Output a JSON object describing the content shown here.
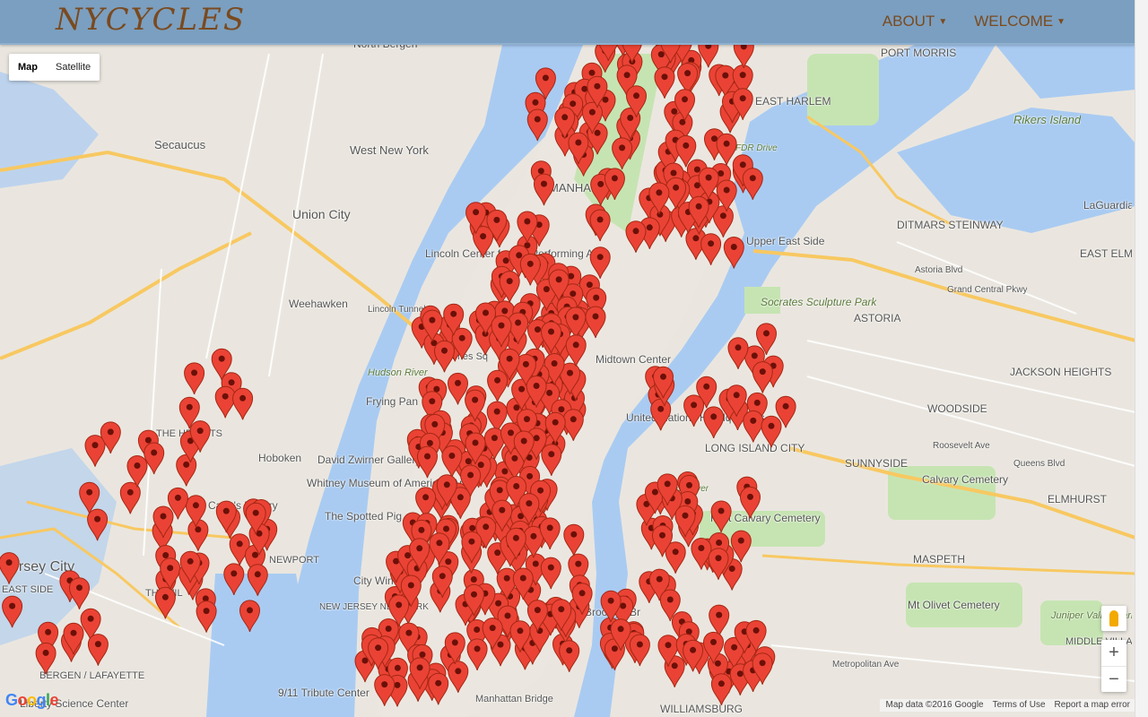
{
  "app": {
    "brand": "NYCYCLES",
    "nav": [
      {
        "label": "ABOUT"
      },
      {
        "label": "WELCOME"
      }
    ]
  },
  "map": {
    "type_controls": {
      "map": "Map",
      "satellite": "Satellite"
    },
    "zoom": {
      "in": "+",
      "out": "−"
    },
    "attribution": {
      "data": "Map data ©2016 Google",
      "terms": "Terms of Use",
      "report": "Report a map error"
    },
    "google_logo": "Google",
    "colors": {
      "water": "#a9cbf2",
      "land": "#eae6df",
      "park": "#c6e4b2",
      "highway": "#f8c861",
      "marker": "#ea4335"
    },
    "labels": [
      {
        "text": "North Bergen"
      },
      {
        "text": "PORT MORRIS"
      },
      {
        "text": "EAST HARLEM"
      },
      {
        "text": "Rikers Island"
      },
      {
        "text": "Secaucus"
      },
      {
        "text": "West New York"
      },
      {
        "text": "Union City"
      },
      {
        "text": "LaGuardia Airport"
      },
      {
        "text": "DITMARS STEINWAY"
      },
      {
        "text": "EAST ELMH"
      },
      {
        "text": "Lincoln Center for the Performing Arts"
      },
      {
        "text": "Weehawken"
      },
      {
        "text": "Socrates Sculpture Park"
      },
      {
        "text": "ASTORIA"
      },
      {
        "text": "JACKSON HEIGHTS"
      },
      {
        "text": "Frying Pan"
      },
      {
        "text": "United Nations Headquarters"
      },
      {
        "text": "WOODSIDE"
      },
      {
        "text": "LONG ISLAND CITY"
      },
      {
        "text": "Hoboken"
      },
      {
        "text": "David Zwirner Gallery"
      },
      {
        "text": "SUNNYSIDE"
      },
      {
        "text": "Calvary Cemetery"
      },
      {
        "text": "ELMHURST"
      },
      {
        "text": "Whitney Museum of American Art"
      },
      {
        "text": "Carlo's Bakery"
      },
      {
        "text": "The Spotted Pig"
      },
      {
        "text": "First Calvary Cemetery"
      },
      {
        "text": "Jersey City"
      },
      {
        "text": "NEWPORT"
      },
      {
        "text": "MASPETH"
      },
      {
        "text": "City Wine"
      },
      {
        "text": "EAST SIDE"
      },
      {
        "text": "THE HEIGHTS"
      },
      {
        "text": "THE VIL"
      },
      {
        "text": "Mt Olivet Cemetery"
      },
      {
        "text": "Juniper Valley Park"
      },
      {
        "text": "Brooklyn Br"
      },
      {
        "text": "MIDDLE VILLA"
      },
      {
        "text": "BERGEN / LAFAYETTE"
      },
      {
        "text": "9/11 Tribute Center"
      },
      {
        "text": "Liberty Science Center"
      },
      {
        "text": "WILLIAMSBURG"
      },
      {
        "text": "Manhattan Bridge"
      },
      {
        "text": "Hudson River"
      },
      {
        "text": "East River"
      },
      {
        "text": "Lincoln Tunnel"
      },
      {
        "text": "FDR Drive"
      },
      {
        "text": "Grand Central Pkwy"
      },
      {
        "text": "MANHATTAN"
      },
      {
        "text": "Upper East Side"
      },
      {
        "text": "Astoria Blvd"
      },
      {
        "text": "Roosevelt Ave"
      },
      {
        "text": "Queens Blvd"
      },
      {
        "text": "NEW JERSEY NEW YORK"
      },
      {
        "text": "Midtown Center"
      },
      {
        "text": "Times Sq"
      },
      {
        "text": "Metropolitan Ave"
      }
    ]
  }
}
